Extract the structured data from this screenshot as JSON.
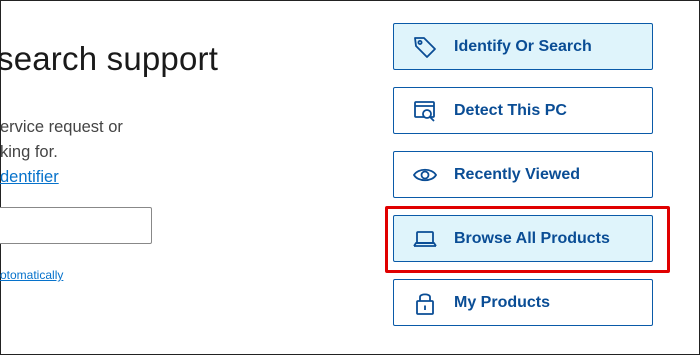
{
  "left": {
    "heading": "search support",
    "desc_line1": "ervice request or",
    "desc_line2": "king for.",
    "identifier_link": "dentifier",
    "search_value": "",
    "detect_link": "otomatically"
  },
  "options": [
    {
      "label": "Identify Or Search",
      "icon": "tag-icon",
      "highlighted": true
    },
    {
      "label": "Detect This PC",
      "icon": "detect-pc-icon",
      "highlighted": false
    },
    {
      "label": "Recently Viewed",
      "icon": "eye-icon",
      "highlighted": false
    },
    {
      "label": "Browse All Products",
      "icon": "laptop-icon",
      "highlighted": true,
      "selected": true
    },
    {
      "label": "My Products",
      "icon": "lock-icon",
      "highlighted": false
    }
  ],
  "colors": {
    "accent": "#0a4d95",
    "highlight_bg": "#dff4fb",
    "selection_border": "#e00000",
    "link": "#0672cb"
  }
}
